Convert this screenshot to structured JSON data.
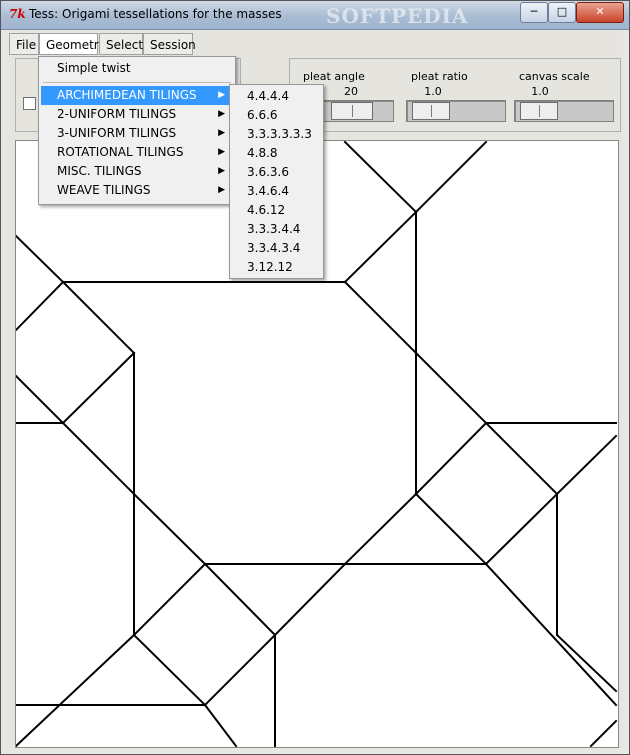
{
  "window": {
    "title": "Tess: Origami tessellations for the masses",
    "watermark": "SOFTPEDIA",
    "buttons": {
      "minimize": "─",
      "maximize": "□",
      "close": "✕"
    },
    "icon": "tk-feather-icon"
  },
  "menubar": [
    {
      "label": "File"
    },
    {
      "label": "Geometry"
    },
    {
      "label": "Select"
    },
    {
      "label": "Session"
    }
  ],
  "controls": {
    "pleat_angle": {
      "label": "pleat angle",
      "value": "20"
    },
    "pleat_ratio": {
      "label": "pleat ratio",
      "value": "1.0"
    },
    "canvas_scale": {
      "label": "canvas scale",
      "value": "1.0"
    }
  },
  "geometry_menu": {
    "first": "Simple twist",
    "items": [
      {
        "label": "ARCHIMEDEAN TILINGS",
        "highlighted": true
      },
      {
        "label": "2-UNIFORM TILINGS"
      },
      {
        "label": "3-UNIFORM TILINGS"
      },
      {
        "label": "ROTATIONAL TILINGS"
      },
      {
        "label": "MISC. TILINGS"
      },
      {
        "label": "WEAVE TILINGS"
      }
    ]
  },
  "archimedean_submenu": [
    "4.4.4.4",
    "6.6.6",
    "3.3.3.3.3.3",
    "4.8.8",
    "3.6.3.6",
    "3.4.6.4",
    "4.6.12",
    "3.3.3.4.4",
    "3.3.4.3.4",
    "3.12.12"
  ],
  "colors": {
    "highlight": "#3399ff",
    "canvas_bg": "#ffffff",
    "line": "#000000"
  }
}
